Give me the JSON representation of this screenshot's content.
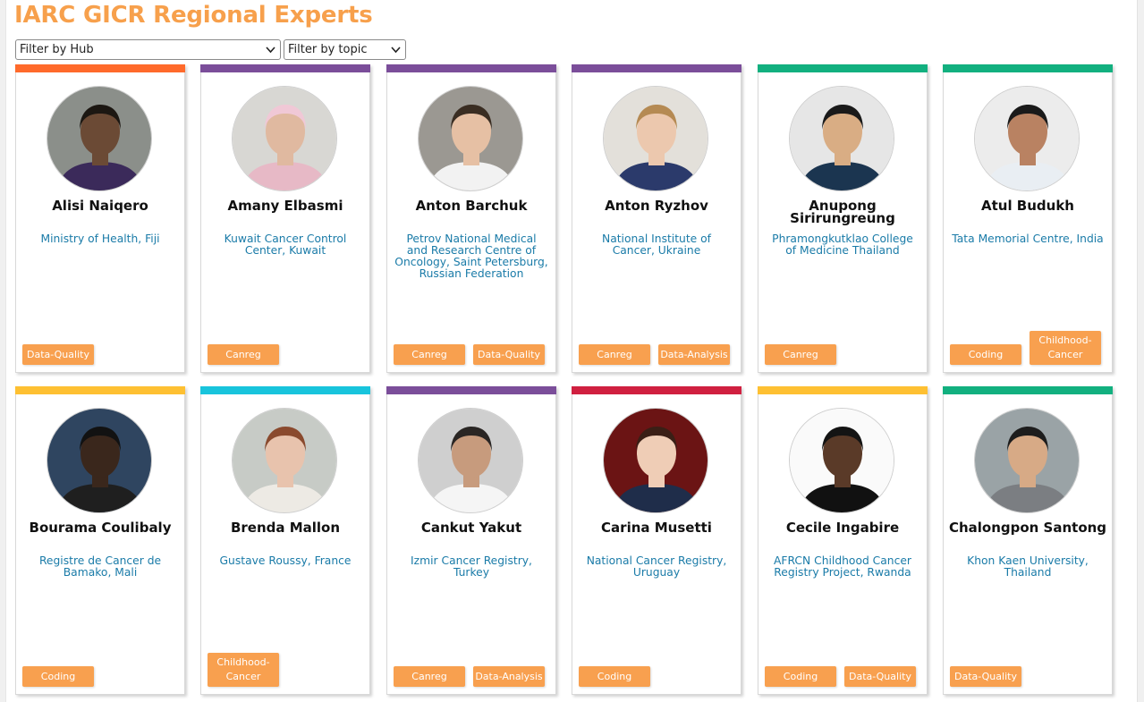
{
  "title": "IARC GICR Regional Experts",
  "filters": {
    "hub": "Filter by Hub",
    "topic": "Filter by topic"
  },
  "colors": {
    "title": "#f7a04c",
    "tag": "#f8a04f",
    "institution": "#1a7ba8",
    "hub_orange": "#ff6a2b",
    "hub_purple": "#7b4e9a",
    "hub_green": "#12b07f",
    "hub_yellow": "#fec032",
    "hub_cyan": "#18c4dc",
    "hub_red": "#d02040"
  },
  "experts": [
    {
      "name": "Alisi Naiqero",
      "institution": "Ministry of Health, Fiji",
      "hub_color": "#ff6a2b",
      "tags": [
        "Data-Quality"
      ]
    },
    {
      "name": "Amany Elbasmi",
      "institution": "Kuwait Cancer Control Center, Kuwait",
      "hub_color": "#7b4e9a",
      "tags": [
        "Canreg"
      ]
    },
    {
      "name": "Anton Barchuk",
      "institution": "Petrov National Medical and Research Centre of Oncology, Saint Petersburg, Russian Federation",
      "hub_color": "#7b4e9a",
      "tags": [
        "Canreg",
        "Data-Quality"
      ]
    },
    {
      "name": "Anton Ryzhov",
      "institution": "National Institute of Cancer, Ukraine",
      "hub_color": "#7b4e9a",
      "tags": [
        "Canreg",
        "Data-Analysis"
      ]
    },
    {
      "name": "Anupong Sirirungreung",
      "institution": "Phramongkutklao College of Medicine Thailand",
      "hub_color": "#12b07f",
      "tags": [
        "Canreg"
      ]
    },
    {
      "name": "Atul Budukh",
      "institution": "Tata Memorial Centre, India",
      "hub_color": "#12b07f",
      "tags": [
        "Coding",
        "Childhood-Cancer"
      ]
    },
    {
      "name": "Bourama Coulibaly",
      "institution": "Registre de Cancer de Bamako, Mali",
      "hub_color": "#fec032",
      "tags": [
        "Coding"
      ]
    },
    {
      "name": "Brenda Mallon",
      "institution": "Gustave Roussy, France",
      "hub_color": "#18c4dc",
      "tags": [
        "Childhood-Cancer"
      ]
    },
    {
      "name": "Cankut Yakut",
      "institution": "Izmir Cancer Registry, Turkey",
      "hub_color": "#7b4e9a",
      "tags": [
        "Canreg",
        "Data-Analysis"
      ]
    },
    {
      "name": "Carina Musetti",
      "institution": "National Cancer Registry, Uruguay",
      "hub_color": "#d02040",
      "tags": [
        "Coding"
      ]
    },
    {
      "name": "Cecile Ingabire",
      "institution": "AFRCN Childhood Cancer Registry Project, Rwanda",
      "hub_color": "#fec032",
      "tags": [
        "Coding",
        "Data-Quality"
      ]
    },
    {
      "name": "Chalongpon Santong",
      "institution": "Khon Kaen University, Thailand",
      "hub_color": "#12b07f",
      "tags": [
        "Data-Quality"
      ]
    }
  ]
}
